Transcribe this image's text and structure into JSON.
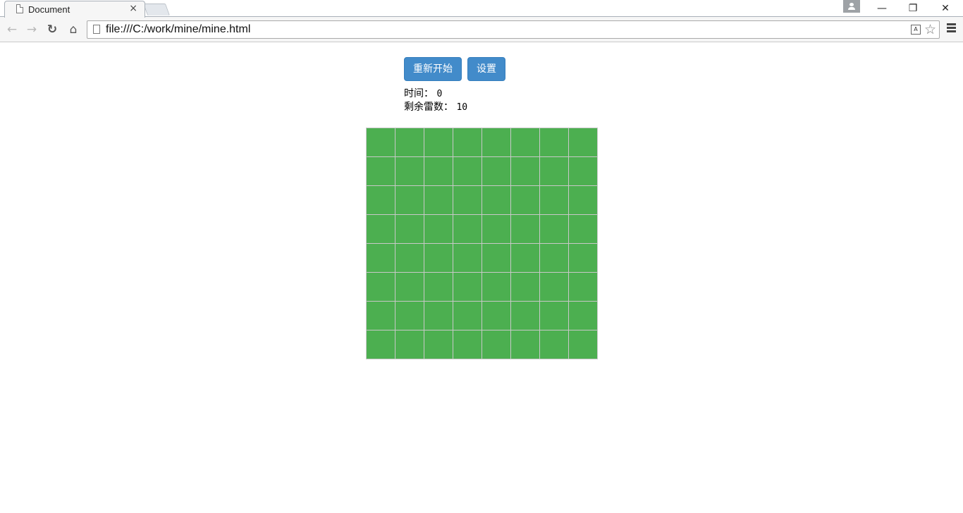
{
  "browser": {
    "tab_title": "Document",
    "tab_close": "×",
    "url": "file:///C:/work/mine/mine.html",
    "win_minimize": "—",
    "win_restore": "❐",
    "win_close": "✕"
  },
  "game": {
    "restart_label": "重新开始",
    "settings_label": "设置",
    "time_label": "时间：",
    "time_value": "0",
    "mines_label": "剩余雷数：",
    "mines_value": "10",
    "rows": 8,
    "cols": 8,
    "cell_color": "#4caf50",
    "button_color": "#428bca"
  },
  "icons": [
    "page-icon",
    "back-arrow-icon",
    "forward-arrow-icon",
    "reload-icon",
    "home-icon",
    "translate-icon",
    "star-icon",
    "menu-icon",
    "avatar-icon"
  ]
}
